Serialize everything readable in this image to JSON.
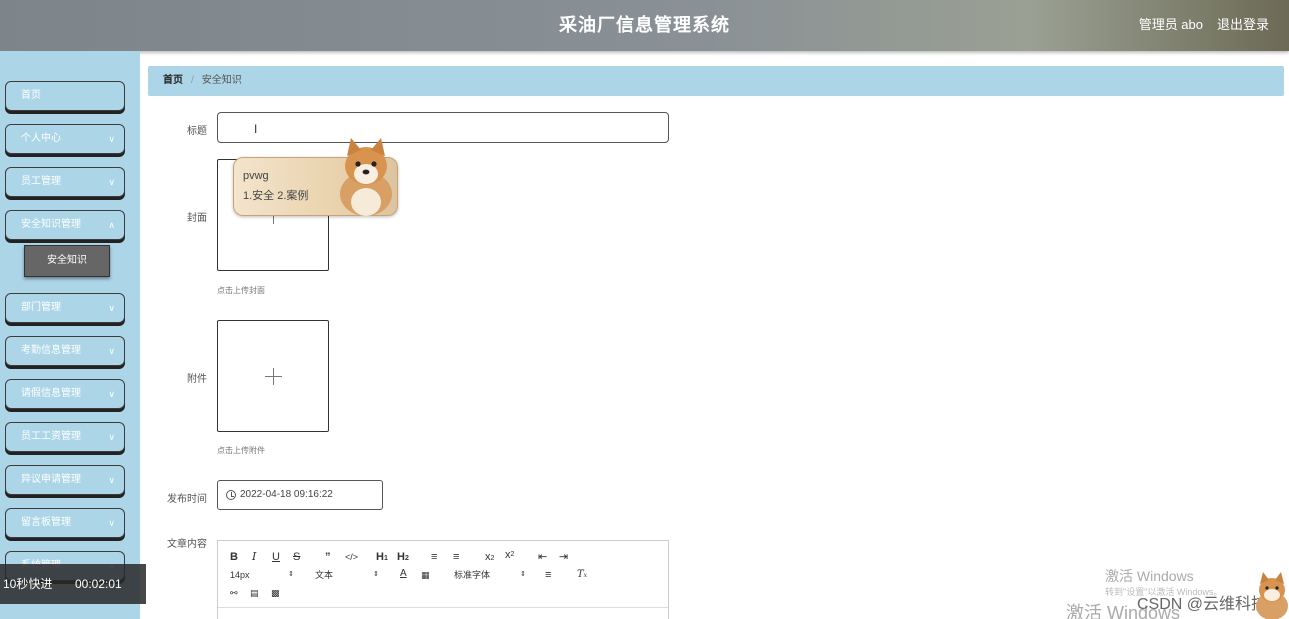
{
  "header": {
    "title": "采油厂信息管理系统",
    "user": "管理员 abo",
    "logout": "退出登录"
  },
  "sidebar": {
    "items": [
      {
        "label": "首页",
        "has_chevron": false
      },
      {
        "label": "个人中心",
        "has_chevron": true
      },
      {
        "label": "员工管理",
        "has_chevron": true
      },
      {
        "label": "安全知识管理",
        "has_chevron": true
      },
      {
        "label": "部门管理",
        "has_chevron": true
      },
      {
        "label": "考勤信息管理",
        "has_chevron": true
      },
      {
        "label": "请假信息管理",
        "has_chevron": true
      },
      {
        "label": "员工工资管理",
        "has_chevron": true
      },
      {
        "label": "异议申请管理",
        "has_chevron": true
      },
      {
        "label": "留言板管理",
        "has_chevron": true
      },
      {
        "label": "系统管理",
        "has_chevron": true
      }
    ],
    "active_sub": "安全知识"
  },
  "breadcrumb": {
    "home": "首页",
    "separator": "/",
    "current": "安全知识"
  },
  "form": {
    "title_label": "标题",
    "cover_label": "封面",
    "cover_hint": "点击上传封面",
    "attachment_label": "附件",
    "attachment_hint": "点击上传附件",
    "publish_time_label": "发布时间",
    "publish_time_value": "2022-04-18 09:16:22",
    "content_label": "文章内容"
  },
  "editor": {
    "font_size": "14px",
    "paragraph": "文本",
    "font_family": "标准字体"
  },
  "ime": {
    "code": "pvwg",
    "candidates": "1.安全  2.案例"
  },
  "video_bar": {
    "speed": "10秒快进",
    "time": "00:02:01"
  },
  "watermark": {
    "activate": "激活 Windows",
    "activate_sub": "转到\"设置\"以激活 Windows。",
    "activate_big": "激活 Windows",
    "csdn": "CSDN @云维科技"
  },
  "colors": {
    "sidebar_bg": "#acd5e8",
    "sub_active_bg": "#666666",
    "header_bg": "#7d858b"
  }
}
